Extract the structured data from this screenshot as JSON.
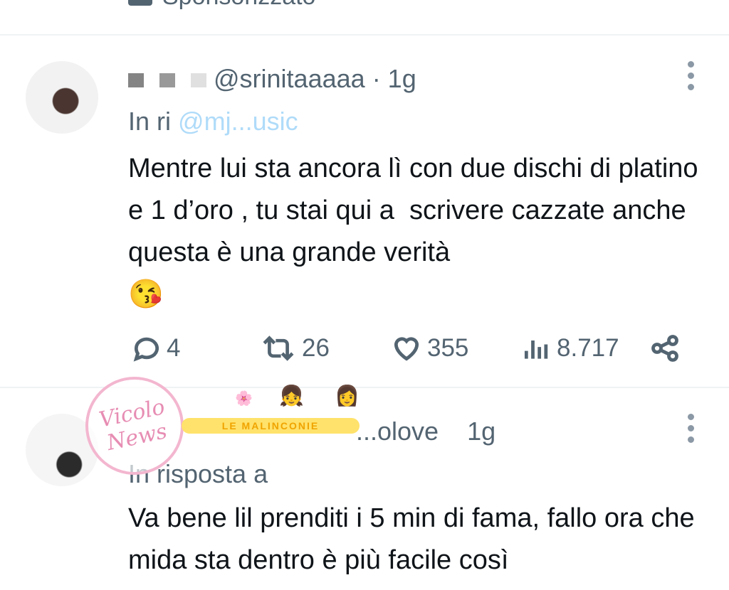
{
  "top": {
    "sponsored_label": "Sponsorizzato"
  },
  "tweet1": {
    "handle": "@srinitaaaaa",
    "time": "· 1g",
    "reply_prefix": "In ri",
    "reply_handle": "@mj...usic",
    "text": "Mentre lui sta ancora lì con due dischi di platino e 1 d’oro , tu stai qui a  scrivere cazzate anche questa è una grande verità",
    "emoji": "😘",
    "stats": {
      "replies": "4",
      "retweets": "26",
      "likes": "355",
      "views": "8.717"
    }
  },
  "tweet2": {
    "handle": "...olove",
    "time": "1g",
    "reply_prefix": "In risposta a",
    "text": "Va bene lil prenditi i 5 min di fama, fallo ora che mida sta dentro è più facile così"
  },
  "watermark": {
    "text": "Vicolo News",
    "banner": "LE MALINCONIE"
  },
  "colors": {
    "accent": "#1d9bf0",
    "secondary_text": "#536471",
    "text": "#0f1419"
  }
}
